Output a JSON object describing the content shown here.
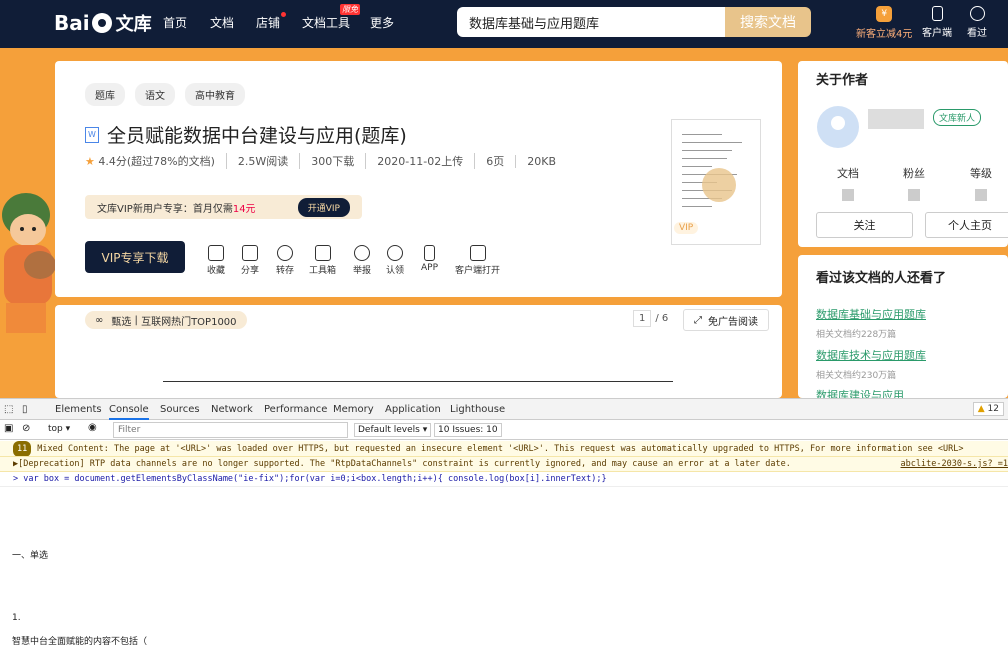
{
  "header": {
    "logo": "Bai  文库",
    "nav": [
      "首页",
      "文档",
      "店铺",
      "文档工具",
      "更多"
    ],
    "nav_badge": "限免",
    "search_value": "数据库基础与应用题库",
    "search_button": "搜索文档",
    "right": [
      "新客立减4元",
      "客户端",
      "看过"
    ]
  },
  "doc": {
    "tags": [
      "题库",
      "语文",
      "高中教育"
    ],
    "title": "全员赋能数据中台建设与应用(题库)",
    "rating": "4.4分",
    "rating_note": "(超过78%的文档)",
    "reads": "2.5W阅读",
    "downloads": "300下载",
    "date": "2020-11-02上传",
    "pages": "6页",
    "size": "20KB",
    "vip_text": "文库VIP新用户专享：首月仅需",
    "vip_price": "14元",
    "vip_open": "开通VIP",
    "download_button": "VIP专享下载",
    "actions": [
      "收藏",
      "分享",
      "转存",
      "工具箱",
      "举报",
      "认领",
      "APP",
      "客户端打开"
    ],
    "thumb_vip": "VIP"
  },
  "reader": {
    "selected_label": "甄选",
    "selected_tag": "互联网热门TOP1000",
    "page_current": "1",
    "page_total": "/ 6",
    "adfree": "免广告阅读"
  },
  "author": {
    "heading": "关于作者",
    "badge": "文库新人",
    "stats": [
      "文档",
      "粉丝",
      "等级"
    ],
    "follow": "关注",
    "homepage": "个人主页"
  },
  "recommend": {
    "heading": "看过该文档的人还看了",
    "items": [
      {
        "title": "数据库基础与应用题库",
        "sub": "相关文档约228万篇"
      },
      {
        "title": "数据库技术与应用题库",
        "sub": "相关文档约230万篇"
      },
      {
        "title": "数据库建设与应用",
        "sub": ""
      }
    ]
  },
  "devtools": {
    "tabs": [
      "Elements",
      "Console",
      "Sources",
      "Network",
      "Performance",
      "Memory",
      "Application",
      "Lighthouse"
    ],
    "active_tab": "Console",
    "issues_count": "12",
    "context": "top",
    "filter_placeholder": "Filter",
    "levels": "Default levels",
    "issues_button": "10 Issues: 10",
    "messages": [
      {
        "badge": "11",
        "text": "Mixed Content: The page at '<URL>' was loaded over HTTPS, but requested an insecure element '<URL>'. This request was automatically upgraded to HTTPS, For more information see <URL>"
      },
      {
        "badge": "",
        "text": "▶[Deprecation] RTP data channels are no longer supported. The \"RtpDataChannels\" constraint is currently ignored, and may cause an error at a later date.",
        "source": "abclite-2030-s.js?_=1"
      },
      {
        "badge": "",
        "text": "> var box = document.getElementsByClassName(\"ie-fix\");for(var i=0;i<box.length;i++){        console.log(box[i].innerText);}"
      }
    ],
    "output": [
      "一、单选",
      "1.",
      "智慧中台全面赋能的内容不包括（"
    ]
  }
}
